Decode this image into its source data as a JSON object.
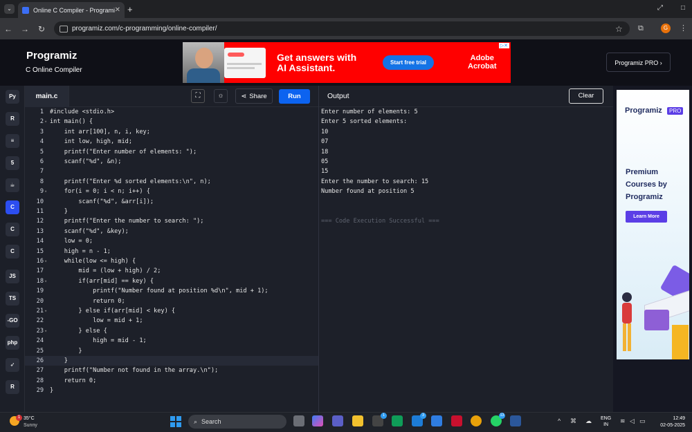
{
  "browser": {
    "tab_title": "Online C Compiler - Programiz",
    "url": "programiz.com/c-programming/online-compiler/",
    "profile_initial": "G"
  },
  "site": {
    "logo": "Programiz",
    "subtitle": "C Online Compiler",
    "pro_button": "Programiz PRO ›"
  },
  "top_ad": {
    "headline_1": "Get answers with",
    "headline_2": "AI Assistant.",
    "cta": "Start free trial",
    "brand_1": "Adobe",
    "brand_2": "Acrobat"
  },
  "rail": {
    "items": [
      "python",
      "r",
      "sql",
      "html",
      "java",
      "c",
      "cpp",
      "csharp",
      "js",
      "ts",
      "go",
      "php",
      "swift",
      "rust"
    ]
  },
  "editor": {
    "file_tab": "main.c",
    "share_label": "Share",
    "run_label": "Run",
    "lines": [
      {
        "n": "1",
        "fold": "",
        "text": "#include <stdio.h>"
      },
      {
        "n": "2",
        "fold": "▾",
        "text": "int main() {"
      },
      {
        "n": "3",
        "fold": "",
        "text": "    int arr[100], n, i, key;"
      },
      {
        "n": "4",
        "fold": "",
        "text": "    int low, high, mid;"
      },
      {
        "n": "5",
        "fold": "",
        "text": "    printf(\"Enter number of elements: \");"
      },
      {
        "n": "6",
        "fold": "",
        "text": "    scanf(\"%d\", &n);"
      },
      {
        "n": "7",
        "fold": "",
        "text": ""
      },
      {
        "n": "8",
        "fold": "",
        "text": "    printf(\"Enter %d sorted elements:\\n\", n);"
      },
      {
        "n": "9",
        "fold": "▾",
        "text": "    for(i = 0; i < n; i++) {"
      },
      {
        "n": "10",
        "fold": "",
        "text": "        scanf(\"%d\", &arr[i]);"
      },
      {
        "n": "11",
        "fold": "",
        "text": "    }"
      },
      {
        "n": "12",
        "fold": "",
        "text": "    printf(\"Enter the number to search: \");"
      },
      {
        "n": "13",
        "fold": "",
        "text": "    scanf(\"%d\", &key);"
      },
      {
        "n": "14",
        "fold": "",
        "text": "    low = 0;"
      },
      {
        "n": "15",
        "fold": "",
        "text": "    high = n - 1;"
      },
      {
        "n": "16",
        "fold": "▾",
        "text": "    while(low <= high) {"
      },
      {
        "n": "17",
        "fold": "",
        "text": "        mid = (low + high) / 2;"
      },
      {
        "n": "18",
        "fold": "▾",
        "text": "        if(arr[mid] == key) {"
      },
      {
        "n": "19",
        "fold": "",
        "text": "            printf(\"Number found at position %d\\n\", mid + 1);"
      },
      {
        "n": "20",
        "fold": "",
        "text": "            return 0;"
      },
      {
        "n": "21",
        "fold": "▾",
        "text": "        } else if(arr[mid] < key) {"
      },
      {
        "n": "22",
        "fold": "",
        "text": "            low = mid + 1;"
      },
      {
        "n": "23",
        "fold": "▾",
        "text": "        } else {"
      },
      {
        "n": "24",
        "fold": "",
        "text": "            high = mid - 1;"
      },
      {
        "n": "25",
        "fold": "",
        "text": "        }"
      },
      {
        "n": "26",
        "fold": "",
        "text": "    }"
      },
      {
        "n": "27",
        "fold": "",
        "text": "    printf(\"Number not found in the array.\\n\");"
      },
      {
        "n": "28",
        "fold": "",
        "text": "    return 0;"
      },
      {
        "n": "29",
        "fold": "",
        "text": "}"
      }
    ],
    "highlighted_line": 26
  },
  "output": {
    "title": "Output",
    "clear_label": "Clear",
    "lines": [
      "Enter number of elements: 5",
      "Enter 5 sorted elements:",
      "10",
      "07",
      "18",
      "05",
      "15",
      "Enter the number to search: 15",
      "Number found at position 5",
      "",
      "",
      "=== Code Execution Successful ==="
    ]
  },
  "side_ad": {
    "logo": "Programiz",
    "badge": "PRO",
    "copy": "Premium Courses by Programiz",
    "cta": "Learn More"
  },
  "taskbar": {
    "temperature": "35°C",
    "condition": "Sunny",
    "weather_badge": "1",
    "search_placeholder": "Search",
    "lang_line1": "ENG",
    "lang_line2": "IN",
    "time": "12:49",
    "date": "02-05-2025"
  },
  "colors": {
    "run_button": "#0c63f0",
    "editor_bg": "#1d2029",
    "ad_red": "#ff0000"
  }
}
